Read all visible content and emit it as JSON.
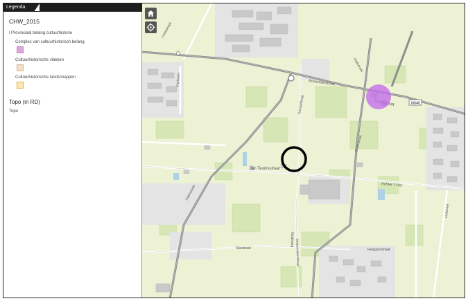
{
  "legend": {
    "tab_label": "Legenda",
    "layer_title": "CHW_2015",
    "group_label": "l Provinciaal belang cultuurhistorie",
    "items": [
      {
        "label": "Complex van cultuurhistorisch belang",
        "color": "#d9a7d8"
      },
      {
        "label": "Cultuurhistorische vlakken",
        "color": "#f3dfc9"
      },
      {
        "label": "Cultuurhistorische landschappen",
        "color": "#fbe9b0"
      }
    ],
    "topo_title": "Topo (in RD)",
    "topo_item": "Topo"
  },
  "map": {
    "labels": {
      "boxschensweg": "Boxschenstraat",
      "kruisstraat": "Kruisstraat",
      "road_code": "N640",
      "jan_teunisstraat": "Jan Teunisstraat",
      "achter_t_hof": "Achter 't Hof",
      "haagsestraat": "Haagsestraat",
      "slastraat": "Slastraat",
      "molenmakerstraat": "Molenmakerstraat",
      "nairnstraat": "Nairnstraat",
      "kalkstraat": "Kalkstraat",
      "grotestraat": "Grotestraat",
      "kanaalstraat": "Kanaalstraat",
      "parklaan": "Parklaan",
      "lindestraat": "Lindestraat",
      "heideweg": "Heideweg",
      "hofstraat": "Hofstraat"
    },
    "colors": {
      "highlight": "#c36ee8",
      "marker": "#000000",
      "road": "#8d8d8d",
      "highway": "#777777"
    },
    "icons": {
      "home": "home-icon",
      "locate": "locate-icon"
    }
  }
}
